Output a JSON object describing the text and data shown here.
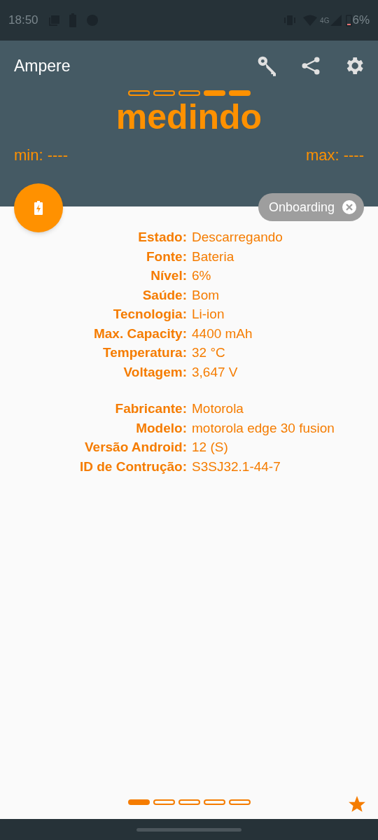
{
  "status_bar": {
    "time": "18:50",
    "network": "4G",
    "battery": "6%"
  },
  "app_bar": {
    "title": "Ampere"
  },
  "meter": {
    "segments": [
      {
        "filled": false
      },
      {
        "filled": false
      },
      {
        "filled": false
      },
      {
        "filled": true
      },
      {
        "filled": true
      }
    ],
    "state": "medindo",
    "min": "min: ----",
    "max": "max: ----"
  },
  "chip": {
    "label": "Onboarding"
  },
  "info_groups": [
    [
      {
        "label": "Estado:",
        "value": "Descarregando"
      },
      {
        "label": "Fonte:",
        "value": "Bateria"
      },
      {
        "label": "Nível:",
        "value": "6%"
      },
      {
        "label": "Saúde:",
        "value": "Bom"
      },
      {
        "label": "Tecnologia:",
        "value": "Li-ion"
      },
      {
        "label": "Max. Capacity:",
        "value": "4400 mAh"
      },
      {
        "label": "Temperatura:",
        "value": "32 °C"
      },
      {
        "label": "Voltagem:",
        "value": "3,647 V"
      }
    ],
    [
      {
        "label": "Fabricante:",
        "value": "Motorola"
      },
      {
        "label": "Modelo:",
        "value": "motorola edge 30 fusion"
      },
      {
        "label": "Versão Android:",
        "value": "12 (S)"
      },
      {
        "label": "ID de Contrução:",
        "value": "S3SJ32.1-44-7"
      }
    ]
  ],
  "pager": [
    {
      "selected": true
    },
    {
      "selected": false
    },
    {
      "selected": false
    },
    {
      "selected": false
    },
    {
      "selected": false
    }
  ]
}
